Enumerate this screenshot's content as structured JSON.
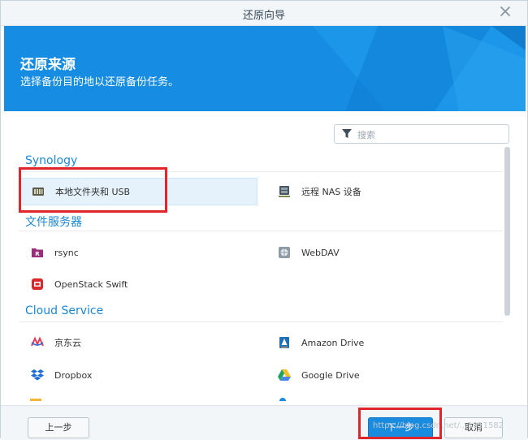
{
  "dialog": {
    "title": "还原向导"
  },
  "banner": {
    "heading": "还原来源",
    "subtitle": "选择备份目的地以还原备份任务。"
  },
  "search": {
    "placeholder": "搜索",
    "value": ""
  },
  "groups": [
    {
      "label": "Synology",
      "items": [
        {
          "label": "本地文件夹和 USB",
          "icon": "local-folder-usb-icon",
          "selected": true
        },
        {
          "label": "远程 NAS 设备",
          "icon": "remote-nas-icon",
          "selected": false
        }
      ]
    },
    {
      "label": "文件服务器",
      "items": [
        {
          "label": "rsync",
          "icon": "rsync-icon",
          "selected": false
        },
        {
          "label": "WebDAV",
          "icon": "webdav-icon",
          "selected": false
        },
        {
          "label": "OpenStack Swift",
          "icon": "openstack-swift-icon",
          "selected": false
        }
      ]
    },
    {
      "label": "Cloud Service",
      "items": [
        {
          "label": "京东云",
          "icon": "jdcloud-icon",
          "selected": false
        },
        {
          "label": "Amazon Drive",
          "icon": "amazon-drive-icon",
          "selected": false
        },
        {
          "label": "Dropbox",
          "icon": "dropbox-icon",
          "selected": false
        },
        {
          "label": "Google Drive",
          "icon": "google-drive-icon",
          "selected": false
        }
      ]
    }
  ],
  "footer": {
    "back_label": "上一步",
    "next_label": "下一步",
    "cancel_label": "取消"
  },
  "watermark": "https://blog.csdn.net/...1911582",
  "colors": {
    "accent": "#1a8ce0",
    "group_label": "#1a87d6",
    "highlight_box": "#e0262b",
    "banner": "#168de2"
  }
}
